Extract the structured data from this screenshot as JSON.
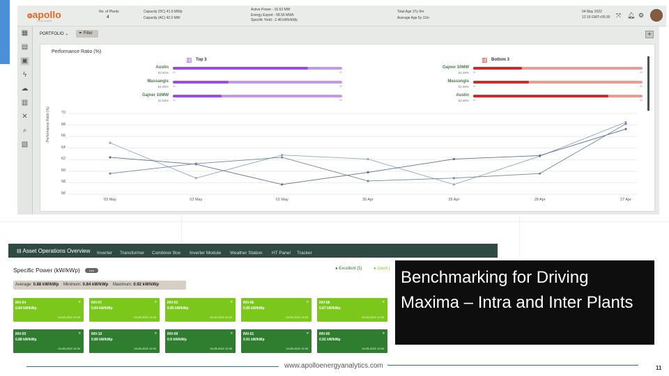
{
  "topbar": {
    "logo": "apollo",
    "logo_sub": "energy analytics",
    "plants_label": "No. of Plants",
    "plants_value": "4",
    "capacity_dc": "Capacity (DC) 41.5 MWp",
    "capacity_ac": "Capacity (AC) 42.0 MW",
    "active_power": "Active Power - 10.63 MW",
    "energy_export": "Energy Export - 58.56 MWh",
    "specific_yield": "Specific Yield - 2.48 kWh/kWp",
    "total_age": "Total Age 27y 9m",
    "average_age": "Average Age 6y 11m",
    "date": "04 May 2022",
    "time": "12:16 GMT+05:30",
    "icons": [
      "expand-icon",
      "bell-icon",
      "gear-icon"
    ]
  },
  "sidebar": {
    "icons": [
      "building-icon",
      "chart-icon",
      "picture-chart-icon",
      "bolt-icon",
      "gear-cloud-icon",
      "cart-icon",
      "tools-icon",
      "search-icon",
      "document-icon"
    ]
  },
  "toolbar": {
    "portfolio_label": "PORTFOLIO",
    "filter_label": "Filter",
    "add_label": "+"
  },
  "performance": {
    "title": "Performance Ratio  (%)",
    "top": {
      "label": "Top 3",
      "items": [
        {
          "name": "Austin",
          "pct": "62.60%",
          "value": 62.6,
          "min": "61",
          "max": "63"
        },
        {
          "name": "Massangis",
          "pct": "61.66%",
          "value": 61.66,
          "min": "61",
          "max": "63"
        },
        {
          "name": "Gajner 10MW",
          "pct": "61.58%",
          "value": 61.58,
          "min": "61",
          "max": "63"
        }
      ]
    },
    "bottom": {
      "label": "Bottom 3",
      "items": [
        {
          "name": "Gajner 10MW",
          "pct": "61.58%",
          "value": 61.58,
          "min": "61",
          "max": "63"
        },
        {
          "name": "Massangis",
          "pct": "61.66%",
          "value": 61.66,
          "min": "61",
          "max": "63"
        },
        {
          "name": "Austin",
          "pct": "62.60%",
          "value": 62.6,
          "min": "61",
          "max": "63"
        }
      ]
    }
  },
  "chart_data": {
    "type": "line",
    "ylabel": "Performance Ratio (%)",
    "ylim": [
      56,
      70
    ],
    "yticks": [
      56,
      58,
      60,
      62,
      64,
      66,
      68,
      70
    ],
    "categories": [
      "03 May",
      "02 May",
      "01 May",
      "30 Apr",
      "29 Apr",
      "28 Apr",
      "27 Apr"
    ],
    "series": [
      {
        "color": "#8fa9bd",
        "values": [
          64.9,
          58.8,
          62.8,
          62.1,
          57.7,
          62.6,
          68.5
        ]
      },
      {
        "color": "#5d6e96",
        "values": [
          62.4,
          61.2,
          57.7,
          59.8,
          62.1,
          62.7,
          67.3
        ]
      },
      {
        "color": "#7284a5",
        "values": [
          59.6,
          61.3,
          62.4,
          58.3,
          58.8,
          59.6,
          68.2
        ]
      }
    ],
    "grid": true
  },
  "asset_ops": {
    "title": "Asset Operations Overview",
    "tabs": [
      "Inverter",
      "Transformer",
      "Combiner Box",
      "Inverter Module",
      "Weather Station",
      "HT Panel",
      "Tracker"
    ],
    "specific_power_title": "Specific Power (kW/kWp)",
    "live_label": "Live",
    "legend_excellent": "Excellent (5)",
    "legend_good": "Good (",
    "average_label": "Average:",
    "average_value": "0.88 kW/kWp",
    "minimum_label": "Minimum:",
    "minimum_value": "0.84 kW/kWp",
    "maximum_label": "Maximum:",
    "maximum_value": "0.92 kW/kWp",
    "inverters": [
      {
        "name": "INV-04",
        "value": "0.84 kW/kWp",
        "time": "04-05-2022 12:30",
        "status": "light"
      },
      {
        "name": "INV-07",
        "value": "0.84 kW/kWp",
        "time": "04-05-2022 12:30",
        "status": "light"
      },
      {
        "name": "INV-02",
        "value": "0.85 kW/kWp",
        "time": "04-05-2022 12:30",
        "status": "light"
      },
      {
        "name": "INV-06",
        "value": "0.85 kW/kWp",
        "time": "04-05-2022 12:30",
        "status": "light"
      },
      {
        "name": "INV-08",
        "value": "0.87 kW/kWp",
        "time": "04-05-2022 12:30",
        "status": "light"
      },
      {
        "name": "INV-03",
        "value": "0.88 kW/kWp",
        "time": "04-05-2022 12:30",
        "status": "dark"
      },
      {
        "name": "INV-10",
        "value": "0.89 kW/kWp",
        "time": "04-05-2022 12:30",
        "status": "dark"
      },
      {
        "name": "INV-09",
        "value": "0.9 kW/kWp",
        "time": "04-05-2022 12:30",
        "status": "dark"
      },
      {
        "name": "INV-01",
        "value": "0.91 kW/kWp",
        "time": "04-05-2022 12:30",
        "status": "dark"
      },
      {
        "name": "INV-05",
        "value": "0.92 kW/kWp",
        "time": "04-05-2022 12:30",
        "status": "dark"
      }
    ]
  },
  "slide": {
    "title": "Benchmarking for Driving Maxima – Intra and Inter Plants",
    "footer_url": "www.apolloenergyanalytics.com",
    "page_number": "11"
  },
  "colors": {
    "top_fill": "#9b4fd6",
    "top_track": "#c39be4",
    "bottom_fill": "#c4302b",
    "bottom_track": "#e79c94",
    "excellent": "#2e7d32",
    "good": "#7bc71c"
  }
}
